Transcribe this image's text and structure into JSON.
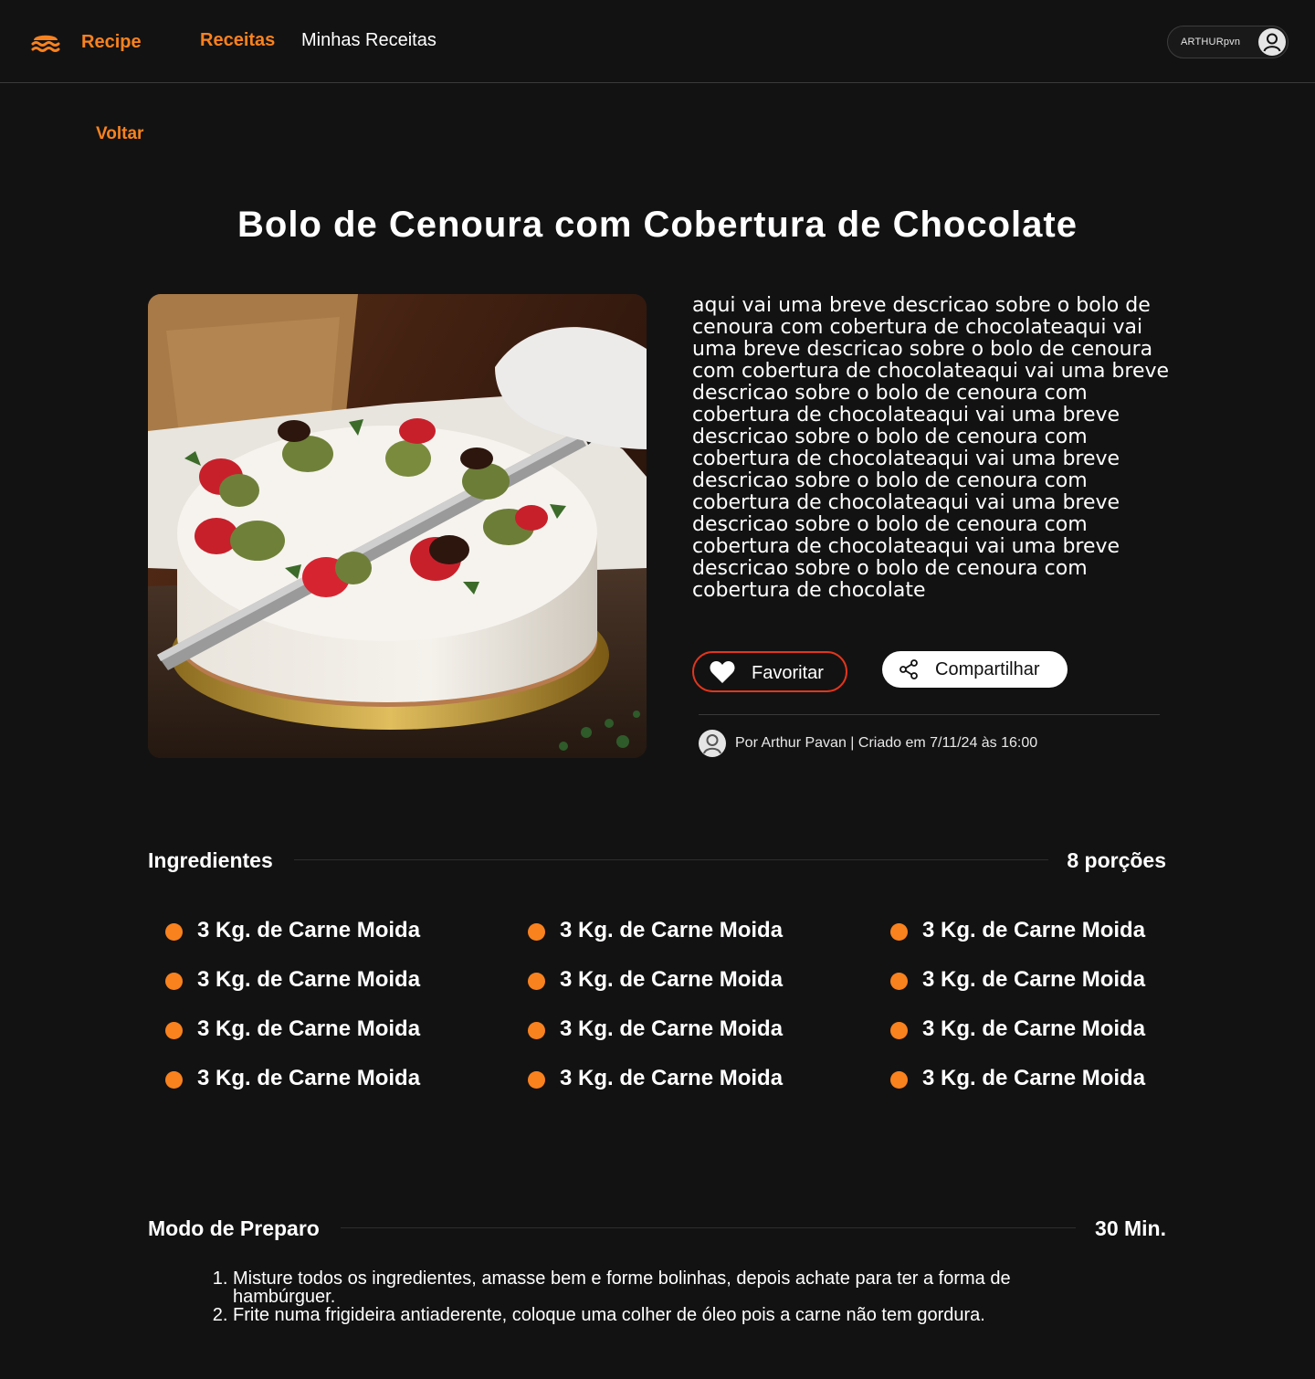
{
  "header": {
    "brand": "Recipe",
    "nav": [
      "Receitas",
      "Minhas Receitas"
    ],
    "user": "ARTHURpvn",
    "accent_color": "#f9821e"
  },
  "back_label": "Voltar",
  "recipe": {
    "title": "Bolo de Cenoura com Cobertura de Chocolate",
    "image": "Bolo branco decorado com morangos cobertos de chocolate e pistache, sendo cortado com faca",
    "description": "aqui vai uma breve descricao sobre o bolo de cenoura com cobertura de chocolateaqui vai uma breve descricao sobre o bolo de cenoura com cobertura de chocolateaqui vai uma breve descricao sobre o bolo de cenoura com cobertura de chocolateaqui vai uma breve descricao sobre o bolo de cenoura com cobertura de chocolateaqui vai uma breve descricao sobre o bolo de cenoura com cobertura de chocolateaqui vai uma breve descricao sobre o bolo de cenoura com cobertura de chocolateaqui vai uma breve descricao sobre o bolo de cenoura com cobertura de chocolate",
    "favorite_label": "Favoritar",
    "share_label": "Compartilhar",
    "meta": "Por Arthur Pavan | Criado em 7/11/24 às 16:00"
  },
  "ingredients": {
    "title": "Ingredientes",
    "portions": "8 porções",
    "items": [
      "3 Kg. de Carne Moida",
      "3 Kg. de Carne Moida",
      "3 Kg. de Carne Moida",
      "3 Kg. de Carne Moida",
      "3 Kg. de Carne Moida",
      "3 Kg. de Carne Moida",
      "3 Kg. de Carne Moida",
      "3 Kg. de Carne Moida",
      "3 Kg. de Carne Moida",
      "3 Kg. de Carne Moida",
      "3 Kg. de Carne Moida",
      "3 Kg. de Carne Moida"
    ]
  },
  "preparation": {
    "title": "Modo de Preparo",
    "time": "30 Min.",
    "steps": [
      "Misture todos os ingredientes, amasse bem e forme bolinhas, depois achate para ter a forma de hambúrguer.",
      "Frite numa frigideira antiaderente, coloque uma colher de óleo pois a carne não tem gordura."
    ]
  }
}
